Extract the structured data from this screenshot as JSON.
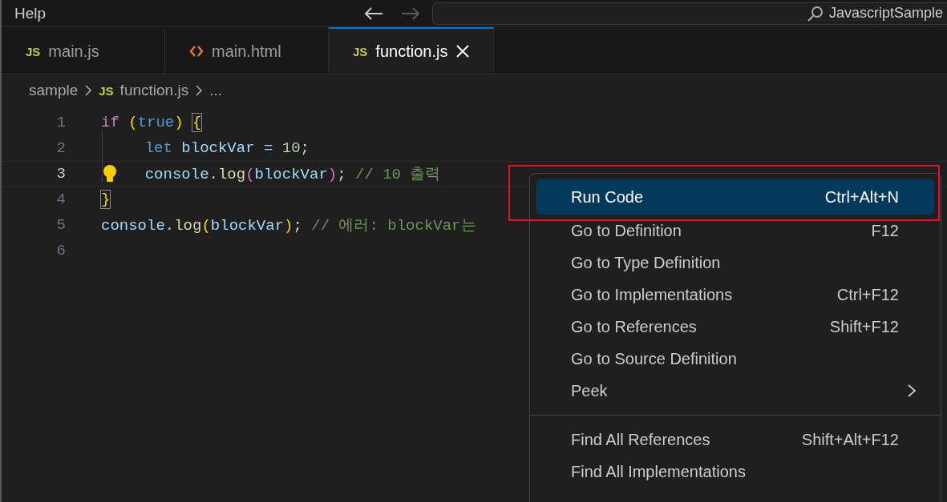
{
  "title_bar": {
    "menu_label": "Help",
    "search": {
      "value": "JavascriptSample"
    }
  },
  "tabs": [
    {
      "label": "main.js",
      "kind": "js",
      "badge": "JS",
      "selected": false
    },
    {
      "label": "main.html",
      "kind": "html",
      "selected": false
    },
    {
      "label": "function.js",
      "kind": "js",
      "badge": "JS",
      "selected": true
    }
  ],
  "breadcrumb": [
    {
      "label": "sample"
    },
    {
      "label": "function.js",
      "kind": "js",
      "badge": "JS"
    },
    {
      "label": "..."
    }
  ],
  "code_lines": [
    {
      "number": "1",
      "current": false,
      "indented": false,
      "tokens": [
        {
          "text": "if ",
          "kind": "keyword"
        },
        {
          "text": "(",
          "kind": "paren"
        },
        {
          "text": "true",
          "kind": "constant"
        },
        {
          "text": ") ",
          "kind": "paren"
        },
        {
          "text": "{",
          "kind": "bracket-match"
        }
      ]
    },
    {
      "number": "2",
      "current": false,
      "indented": true,
      "tokens": [
        {
          "text": "let ",
          "kind": "constant"
        },
        {
          "text": "blockVar = ",
          "kind": "variable"
        },
        {
          "text": "10",
          "kind": "number"
        },
        {
          "text": ";",
          "kind": "plain"
        }
      ]
    },
    {
      "number": "3",
      "current": true,
      "indented": true,
      "tokens": [
        {
          "text": "console.",
          "kind": "variable"
        },
        {
          "text": "log",
          "kind": "function"
        },
        {
          "text": "(",
          "kind": "paren2"
        },
        {
          "text": "blockVar",
          "kind": "variable"
        },
        {
          "text": ")",
          "kind": "paren2"
        },
        {
          "text": "; ",
          "kind": "plain"
        },
        {
          "text": "// 10 출력",
          "kind": "comment"
        }
      ]
    },
    {
      "number": "4",
      "current": false,
      "indented": false,
      "tokens": [
        {
          "text": "}",
          "kind": "bracket-match"
        }
      ]
    },
    {
      "number": "5",
      "current": false,
      "indented": false,
      "tokens": [
        {
          "text": "console.",
          "kind": "variable"
        },
        {
          "text": "log",
          "kind": "function"
        },
        {
          "text": "(",
          "kind": "paren"
        },
        {
          "text": "blockVar",
          "kind": "variable"
        },
        {
          "text": ")",
          "kind": "paren"
        },
        {
          "text": "; ",
          "kind": "plain"
        },
        {
          "text": "// 에러: blockVar는",
          "kind": "comment"
        }
      ]
    },
    {
      "number": "6",
      "current": false
    }
  ],
  "context_menu": [
    {
      "kind": "item",
      "label": "Run Code",
      "shortcut": "Ctrl+Alt+N",
      "selected": true
    },
    {
      "kind": "item",
      "label": "Go to Definition",
      "shortcut": "F12",
      "selected": false
    },
    {
      "kind": "item",
      "label": "Go to Type Definition",
      "selected": false
    },
    {
      "kind": "item",
      "label": "Go to Implementations",
      "shortcut": "Ctrl+F12",
      "selected": false
    },
    {
      "kind": "item",
      "label": "Go to References",
      "shortcut": "Shift+F12",
      "selected": false
    },
    {
      "kind": "item",
      "label": "Go to Source Definition",
      "selected": false
    },
    {
      "kind": "item",
      "label": "Peek",
      "submenu": true,
      "selected": false
    },
    {
      "kind": "separator"
    },
    {
      "kind": "item",
      "label": "Find All References",
      "shortcut": "Shift+Alt+F12",
      "selected": false
    },
    {
      "kind": "item",
      "label": "Find All Implementations",
      "selected": false
    }
  ]
}
